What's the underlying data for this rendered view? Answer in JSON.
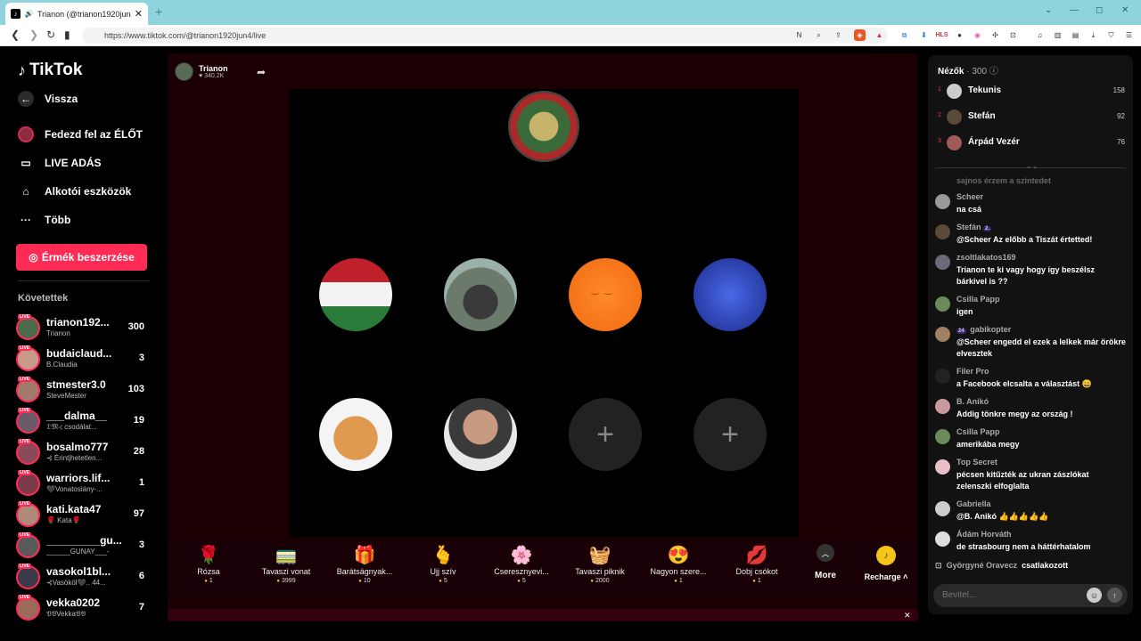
{
  "browser": {
    "tab_title": "Trianon (@trianon1920jun4)",
    "new_tab": "+",
    "url": "https://www.tiktok.com/@trianon1920jun4/live",
    "controls": [
      "⌄",
      "—",
      "◻",
      "✕"
    ]
  },
  "sidebar": {
    "logo": "TikTok",
    "back": "Vissza",
    "nav": [
      {
        "label": "Fedezd fel az ÉLŐT",
        "icon": "explore-live-icon"
      },
      {
        "label": "LIVE ADÁS",
        "icon": "video-camera-icon"
      },
      {
        "label": "Alkotói eszközök",
        "icon": "creator-tools-icon"
      },
      {
        "label": "Több",
        "icon": "more-dots-icon"
      }
    ],
    "coins_button": "Érmék beszerzése",
    "following_header": "Követettek",
    "following": [
      {
        "name": "trianon192...",
        "sub": "Trianon",
        "count": "300"
      },
      {
        "name": "budaiclaud...",
        "sub": "B.Claudia",
        "count": "3"
      },
      {
        "name": "stmester3.0",
        "sub": "SteveMester",
        "count": "103"
      },
      {
        "name": "___dalma__",
        "sub": "𝔇𝔐⊰ csodálat...",
        "count": "19"
      },
      {
        "name": "bosalmo777",
        "sub": "⊰ Érintjhetetlen...",
        "count": "28"
      },
      {
        "name": "warriors.lif...",
        "sub": "🖤Vonatoslány-...",
        "count": "1"
      },
      {
        "name": "kati.kata47",
        "sub": "🌹 Kata🌹",
        "count": "97"
      },
      {
        "name": "_________gu...",
        "sub": "______GUNAY___-",
        "count": "3"
      },
      {
        "name": "vasokol1bl...",
        "sub": "⊰Vasököl🖤.. 44...",
        "count": "6"
      },
      {
        "name": "vekka0202",
        "sub": "𝔙𝔙Vekka𝔙𝔙",
        "count": "7"
      }
    ]
  },
  "stream": {
    "host_name": "Trianon",
    "host_likes": "♥ 340.2K",
    "gifts": [
      {
        "name": "Rózsa",
        "price": "1",
        "icon": "🌹"
      },
      {
        "name": "Tavaszi vonat",
        "price": "3999",
        "icon": "🚃"
      },
      {
        "name": "Barátságnyak...",
        "price": "10",
        "icon": "🎁"
      },
      {
        "name": "Ujj szív",
        "price": "5",
        "icon": "🫰"
      },
      {
        "name": "Cseresznyevi...",
        "price": "5",
        "icon": "🌸"
      },
      {
        "name": "Tavaszi piknik",
        "price": "2000",
        "icon": "🧺"
      },
      {
        "name": "Nagyon szere...",
        "price": "1",
        "icon": "😍"
      },
      {
        "name": "Dobj csókot",
        "price": "1",
        "icon": "💋"
      }
    ],
    "more_label": "More",
    "recharge_label": "Recharge",
    "empty_seat": "+"
  },
  "chat": {
    "viewers_label": "Nézők",
    "viewers_count": "· 300",
    "top_viewers": [
      {
        "rank": "1",
        "name": "Tekunis",
        "score": "158"
      },
      {
        "rank": "2",
        "name": "Stefán",
        "score": "92"
      },
      {
        "rank": "3",
        "name": "Árpád Vezér",
        "score": "76"
      }
    ],
    "faded_message": "sajnos érzem a szintedet",
    "messages": [
      {
        "user": "Scheer",
        "text": "na csá"
      },
      {
        "user": "Stefán",
        "badge": "2.",
        "text": "@Scheer Az előbb a Tiszát értetted!"
      },
      {
        "user": "zsoltlakatos169",
        "text": "Trianon te ki vagy hogy így beszélsz bárkivel is ??"
      },
      {
        "user": "Csilla Papp",
        "text": "igen"
      },
      {
        "user": "gabikopter",
        "badge": "24",
        "text": "@Scheer engedd el ezek a lelkek már örökre elvesztek"
      },
      {
        "user": "Filer Pro",
        "text": "a Facebook elcsalta a választást 😄"
      },
      {
        "user": "B. Anikó",
        "text": "Addig tönkre megy az ország !"
      },
      {
        "user": "Csilla Papp",
        "text": "amerikába megy"
      },
      {
        "user": "Top Secret",
        "text": "pécsen kitűzték az ukran zászlókat zelenszki elfoglalta"
      },
      {
        "user": "Gabriella",
        "text": "@B. Anikó 👍👍👍👍👍"
      },
      {
        "user": "Ádám Horváth",
        "text": "de strasbourg nem a háttérhatalom"
      }
    ],
    "join_user": "Györgyné Oravecz",
    "join_text": "csatlakozott",
    "input_placeholder": "Bevitel..."
  }
}
